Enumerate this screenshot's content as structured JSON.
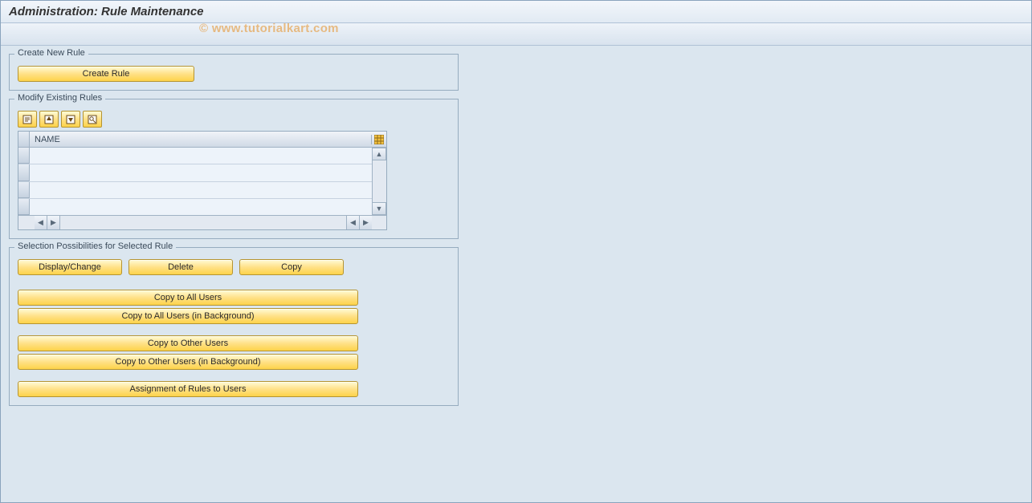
{
  "title": "Administration: Rule Maintenance",
  "watermark": "© www.tutorialkart.com",
  "panels": {
    "create": {
      "title": "Create New Rule",
      "create_rule_label": "Create Rule"
    },
    "modify": {
      "title": "Modify Existing Rules",
      "column_header": "NAME"
    },
    "selection": {
      "title": "Selection Possibilities for Selected Rule",
      "display_change_label": "Display/Change",
      "delete_label": "Delete",
      "copy_label": "Copy",
      "copy_all_label": "Copy to All Users",
      "copy_all_bg_label": "Copy to All Users (in Background)",
      "copy_other_label": "Copy to Other Users",
      "copy_other_bg_label": "Copy to Other Users (in Background)",
      "assignment_label": "Assignment of Rules to Users"
    }
  }
}
